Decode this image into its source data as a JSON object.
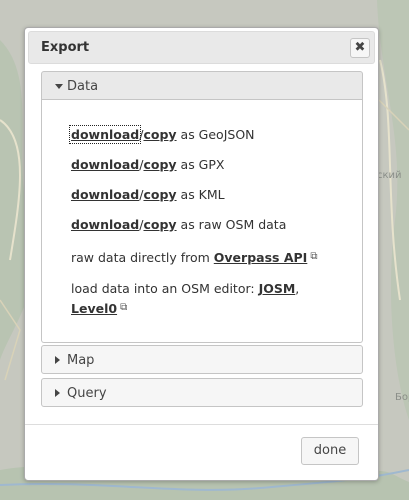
{
  "map": {
    "labels": [
      "ский",
      "Бор"
    ]
  },
  "dialog": {
    "title": "Export",
    "close_icon": "close-icon",
    "done_label": "done"
  },
  "sections": {
    "data": {
      "label": "Data",
      "download": "download",
      "sep": "/",
      "copy": "copy",
      "geojson_suffix": " as GeoJSON",
      "gpx_suffix": " as GPX",
      "kml_suffix": " as KML",
      "osm_suffix": " as raw OSM data",
      "raw_prefix": "raw data directly from ",
      "overpass_link": "Overpass API",
      "editor_prefix": "load data into an OSM editor: ",
      "josm_link": "JOSM",
      "comma": ",",
      "level0_link": "Level0",
      "external_icon": "external-link-icon"
    },
    "map": {
      "label": "Map"
    },
    "query": {
      "label": "Query"
    }
  }
}
